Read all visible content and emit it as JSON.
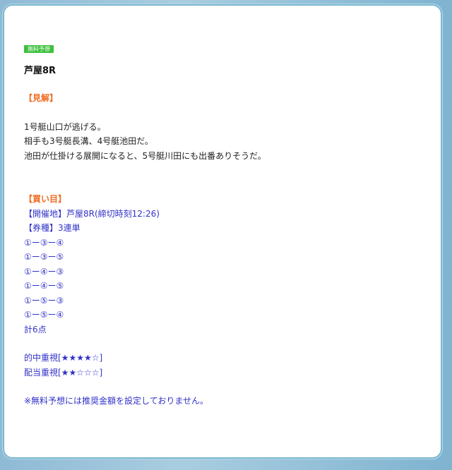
{
  "badge": "無料予想",
  "race_title": "芦屋8R",
  "opinion": {
    "heading": "【見解】",
    "lines": [
      "1号艇山口が逃げる。",
      "相手も3号艇長溝、4号艇池田だ。",
      "池田が仕掛ける展開になると、5号艇川田にも出番ありそうだ。"
    ]
  },
  "buy": {
    "heading": "【買い目】",
    "venue": "【開催地】芦屋8R(締切時刻12:26)",
    "ticket_type": "【券種】3連単",
    "combos": [
      "①ー③ー④",
      "①ー③ー⑤",
      "①ー④ー③",
      "①ー④ー⑤",
      "①ー⑤ー③",
      "①ー⑤ー④"
    ],
    "total": "計6点"
  },
  "ratings": {
    "accuracy": "的中重視[★★★★☆]",
    "payout": "配当重視[★★☆☆☆]"
  },
  "note": "※無料予想には推奨金額を設定しておりません。",
  "colors": {
    "badge_bg": "#3ec13e",
    "heading": "#f06d24",
    "blue_text": "#3232c8"
  }
}
